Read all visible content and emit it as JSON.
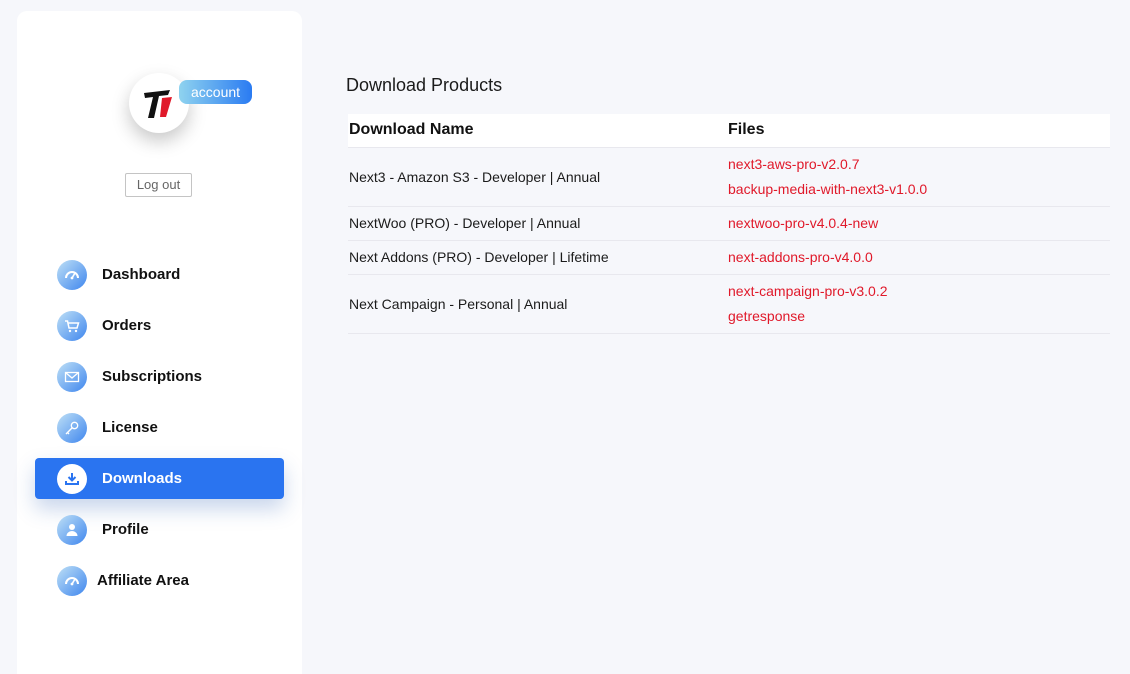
{
  "sidebar": {
    "account_badge": "account",
    "logout_label": "Log out",
    "items": [
      {
        "label": "Dashboard",
        "icon": "dashboard-icon",
        "active": false
      },
      {
        "label": "Orders",
        "icon": "cart-icon",
        "active": false
      },
      {
        "label": "Subscriptions",
        "icon": "mail-icon",
        "active": false
      },
      {
        "label": "License",
        "icon": "key-icon",
        "active": false
      },
      {
        "label": "Downloads",
        "icon": "download-icon",
        "active": true
      },
      {
        "label": "Profile",
        "icon": "user-icon",
        "active": false
      },
      {
        "label": "Affiliate Area",
        "icon": "dashboard-icon",
        "active": false
      }
    ]
  },
  "main": {
    "title": "Download Products",
    "table": {
      "headers": [
        "Download Name",
        "Files"
      ],
      "rows": [
        {
          "name": "Next3 - Amazon S3 - Developer | Annual",
          "files": [
            "next3-aws-pro-v2.0.7",
            "backup-media-with-next3-v1.0.0"
          ]
        },
        {
          "name": "NextWoo (PRO) - Developer | Annual",
          "files": [
            "nextwoo-pro-v4.0.4-new"
          ]
        },
        {
          "name": "Next Addons (PRO) - Developer | Lifetime",
          "files": [
            "next-addons-pro-v4.0.0"
          ]
        },
        {
          "name": "Next Campaign - Personal | Annual",
          "files": [
            "next-campaign-pro-v3.0.2",
            "getresponse"
          ]
        }
      ]
    }
  },
  "colors": {
    "accent": "#2a74f0",
    "link": "#e0192a",
    "background": "#f6f7fb"
  }
}
